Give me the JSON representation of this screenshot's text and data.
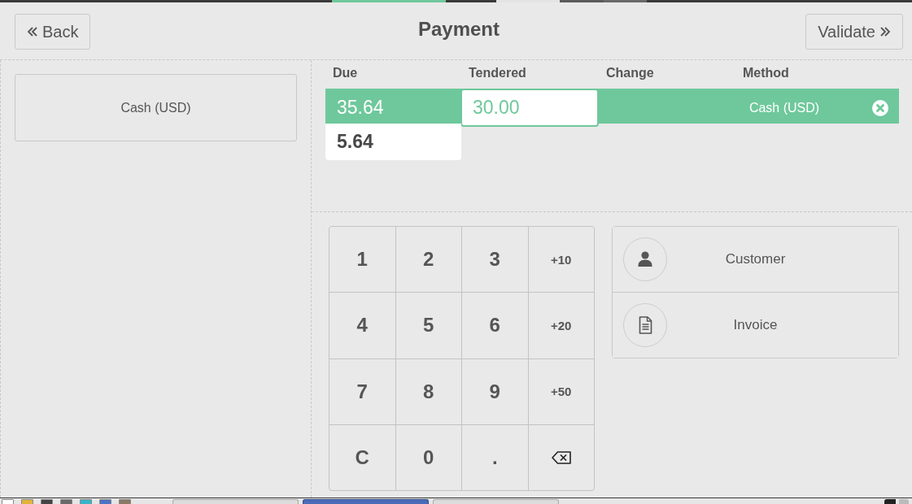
{
  "header": {
    "back_button": {
      "label": "Back"
    },
    "title": "Payment",
    "validate_button": {
      "label": "Validate"
    }
  },
  "payment_methods": [
    {
      "label": "Cash (USD)"
    }
  ],
  "paymentlines": {
    "columns": [
      "Due",
      "Tendered",
      "Change",
      "Method"
    ],
    "lines": [
      {
        "due": "35.64",
        "tendered": "30.00",
        "method": "Cash (USD)",
        "selected": true
      }
    ],
    "remaining": "5.64"
  },
  "numpad": {
    "keys": [
      {
        "kind": "digit",
        "label": "1"
      },
      {
        "kind": "digit",
        "label": "2"
      },
      {
        "kind": "digit",
        "label": "3"
      },
      {
        "kind": "amount",
        "label": "+10"
      },
      {
        "kind": "digit",
        "label": "4"
      },
      {
        "kind": "digit",
        "label": "5"
      },
      {
        "kind": "digit",
        "label": "6"
      },
      {
        "kind": "amount",
        "label": "+20"
      },
      {
        "kind": "digit",
        "label": "7"
      },
      {
        "kind": "digit",
        "label": "8"
      },
      {
        "kind": "digit",
        "label": "9"
      },
      {
        "kind": "amount",
        "label": "+50"
      },
      {
        "kind": "digit",
        "label": "C"
      },
      {
        "kind": "digit",
        "label": "0"
      },
      {
        "kind": "digit",
        "label": "."
      },
      {
        "kind": "backspace"
      }
    ]
  },
  "actions": [
    {
      "kind": "customer",
      "label": "Customer"
    },
    {
      "kind": "invoice",
      "label": "Invoice"
    }
  ],
  "taskbar": {
    "windows": [
      {
        "selected": false
      },
      {
        "selected": true
      },
      {
        "selected": false
      }
    ]
  }
}
